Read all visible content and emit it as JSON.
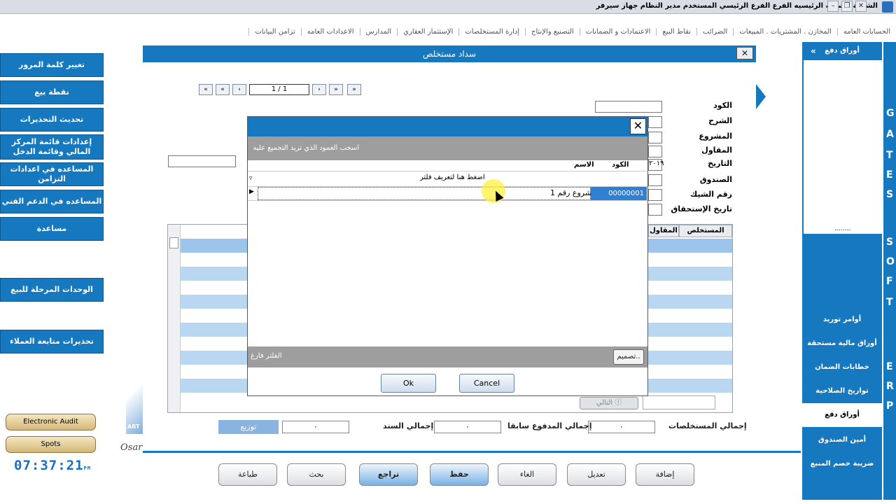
{
  "titlebar": {
    "text": "الشركة  الشركه الرئيسيه    الفرع  الفرع الرئيسي    المستخدم  مدير النظام    جهاز  سيرفر"
  },
  "top_menu": [
    "الحسابات العامه",
    "المخازن . المشتريات . المبيعات",
    "الضرائب",
    "نقاط البيع",
    "الاعتمادات و الضمانات",
    "التصنيع والإنتاج",
    "إدارة المستخلصات",
    "الإستثمار العقاري",
    "المدارس",
    "الاعدادات العامه",
    "تزامن البيانات"
  ],
  "left_sidebar": {
    "buttons": [
      "تغيير كلمة المرور",
      "نقطة بيع",
      "تحديث التحذيرات",
      "إعدادات قائمة المركز المالي وقائمة الدخل",
      "المساعده في اعدادات التزامن",
      "المساعده في الدعم الفني",
      "مساعدة",
      "الوحدات المرحلة للبيع",
      "تحذيرات متابعة العملاء"
    ],
    "pills": [
      "Electronic Audit",
      "Spots"
    ],
    "clock": "07:37:21",
    "clock_suffix": "PM"
  },
  "right_sidebar": {
    "header": "أوراق دفع",
    "dots": "........",
    "items": [
      "أوامر توريد",
      "أوراق مالية مستحقة",
      "خطابات الضمان",
      "تواريخ الصلاحية",
      "أوراق دفع",
      "أمين الصندوق",
      "ضريبة خصم المنبع"
    ],
    "active_index": 4,
    "strip_letters": [
      "G",
      "A",
      "T",
      "E",
      "S",
      "S",
      "O",
      "F",
      "T",
      "E",
      "R",
      "P"
    ]
  },
  "form": {
    "title": "سداد مستخلص",
    "nav_position": "1 / 1",
    "labels": {
      "code": "الكود",
      "description": "الشرح",
      "project": "المشروع",
      "contractor": "المقاول",
      "date": "التاريخ",
      "fund": "الصندوق",
      "check_no": "رقم الشيك",
      "due_date": "تاريخ الإستحقاق"
    },
    "date_value": "٢٠١٩",
    "grid_headers": [
      "المستخلص",
      "المقاول"
    ],
    "next_label": "التالي",
    "totals": {
      "extracts_label": "إجمالي المستخلصات",
      "extracts_value": "٠",
      "prev_paid_label": "إجمالي المدفوع سابقا",
      "prev_paid_value": "٠",
      "doc_label": "إجمالي السند",
      "doc_value": "٠",
      "distribute_label": "توزيع"
    },
    "logo": "Osar",
    "deco_text": "ART"
  },
  "actions": [
    "إضافة",
    "تعديل",
    "الغاء",
    "حفظ",
    "تراجع",
    "بحث",
    "طباعة"
  ],
  "dialog": {
    "group_hint": "اسحب العمود الذي تريد التجميع عليه",
    "col_code": "الكود",
    "col_name": "الاسم",
    "filter_hint": "اضغط هنا لتعريف فلتر",
    "row_code": "00000001",
    "row_name": "مشروع رقم 1",
    "filter_status": "الفلتر فارغ",
    "customize_label": "تصميم..",
    "ok_label": "Ok",
    "cancel_label": "Cancel"
  },
  "colors": {
    "accent": "#1678be",
    "selected_row": "#b9d7f1"
  }
}
